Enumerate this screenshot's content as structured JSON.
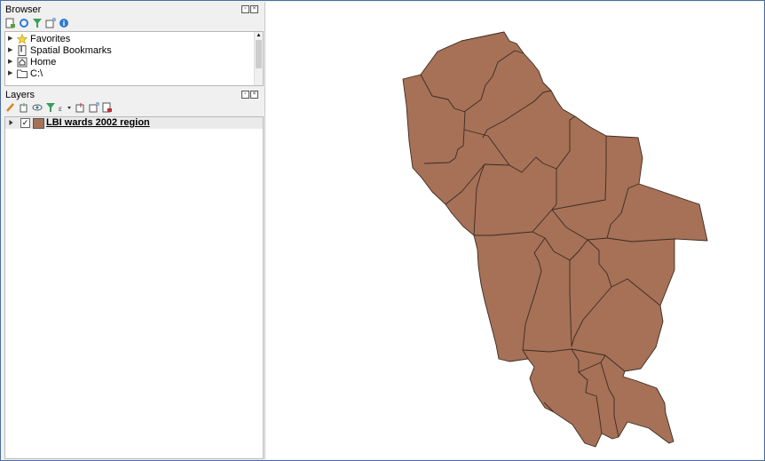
{
  "browser": {
    "title": "Browser",
    "items": [
      {
        "label": "Favorites",
        "icon": "star-icon"
      },
      {
        "label": "Spatial Bookmarks",
        "icon": "bookmark-icon"
      },
      {
        "label": "Home",
        "icon": "home-icon"
      },
      {
        "label": "C:\\",
        "icon": "folder-icon"
      }
    ]
  },
  "layers": {
    "title": "Layers",
    "items": [
      {
        "label": "LBI wards 2002 region",
        "checked": true,
        "fill_color": "#a67157"
      }
    ]
  },
  "map": {
    "fill_color": "#a67157",
    "stroke_color": "#3b2b22"
  }
}
